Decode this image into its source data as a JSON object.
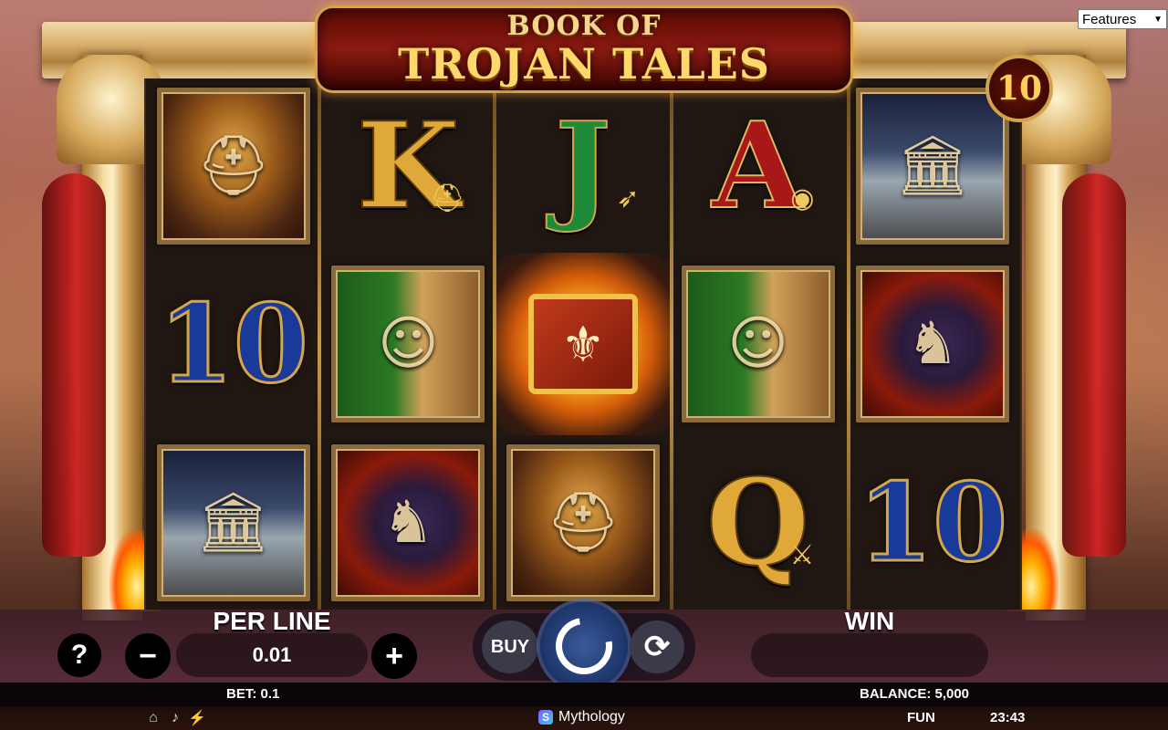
{
  "features_select": {
    "selected": "Features"
  },
  "logo": {
    "line1": "BOOK OF",
    "line2": "TROJAN TALES"
  },
  "lines_badge": "10",
  "reels": [
    [
      {
        "kind": "image",
        "symbol": "warrior",
        "icon": "helmet-icon"
      },
      {
        "kind": "letter",
        "text": "10",
        "style": "blue"
      },
      {
        "kind": "image",
        "symbol": "temple",
        "icon": "temple-icon"
      }
    ],
    [
      {
        "kind": "letter",
        "text": "K",
        "style": "gold",
        "accent": "helmet-icon"
      },
      {
        "kind": "image",
        "symbol": "helen",
        "icon": "portrait-icon"
      },
      {
        "kind": "image",
        "symbol": "horse",
        "icon": "horse-icon"
      }
    ],
    [
      {
        "kind": "letter",
        "text": "J",
        "style": "green",
        "accent": "arrow-icon"
      },
      {
        "kind": "scatter",
        "symbol": "book",
        "icon": "book-icon"
      },
      {
        "kind": "image",
        "symbol": "warrior",
        "icon": "helmet-icon"
      }
    ],
    [
      {
        "kind": "letter",
        "text": "A",
        "style": "red",
        "accent": "shield-icon"
      },
      {
        "kind": "image",
        "symbol": "helen",
        "icon": "portrait-icon"
      },
      {
        "kind": "letter",
        "text": "Q",
        "style": "gold",
        "accent": "swords-icon"
      }
    ],
    [
      {
        "kind": "image",
        "symbol": "temple",
        "icon": "temple-icon"
      },
      {
        "kind": "image",
        "symbol": "horse",
        "icon": "horse-icon"
      },
      {
        "kind": "letter",
        "text": "10",
        "style": "blue"
      }
    ]
  ],
  "controls": {
    "help_label": "?",
    "minus_label": "−",
    "plus_label": "+",
    "per_line_label": "PER LINE",
    "per_line_value": "0.01",
    "buy_label": "BUY",
    "win_label": "WIN",
    "win_value": ""
  },
  "info": {
    "bet": "BET: 0.1",
    "balance": "BALANCE: 5,000"
  },
  "footer": {
    "icons": [
      "home-icon",
      "sound-icon",
      "turbo-icon"
    ],
    "brand": "Mythology",
    "brand_mark": "S",
    "mode": "FUN",
    "clock": "23:43"
  }
}
